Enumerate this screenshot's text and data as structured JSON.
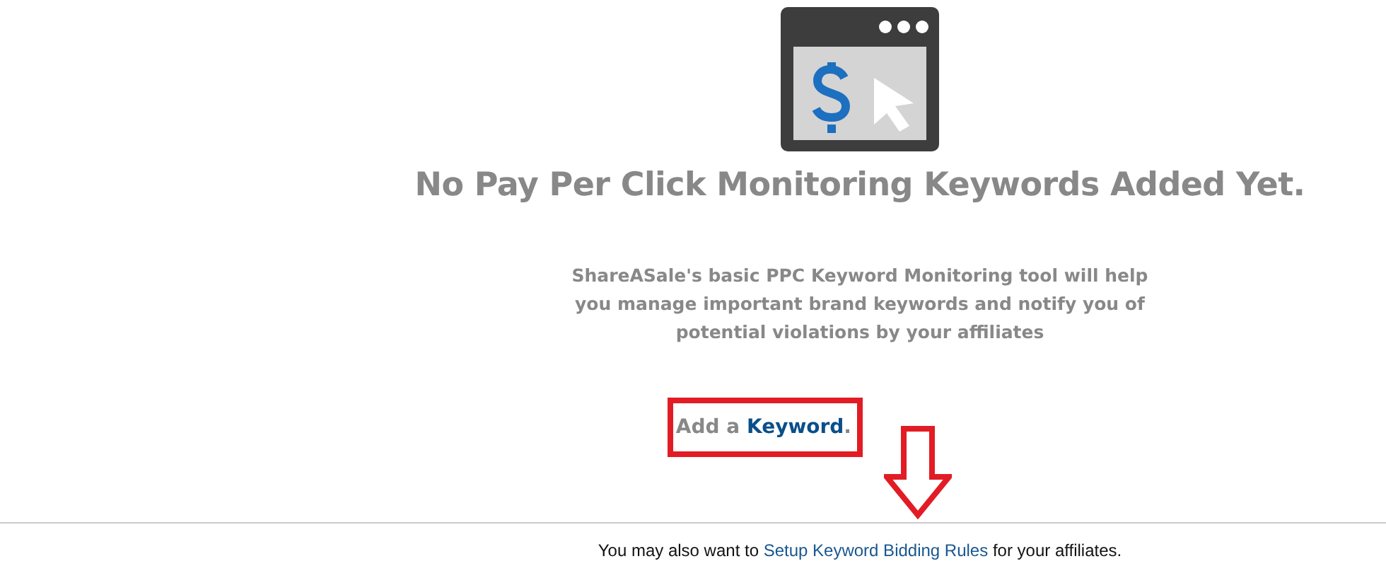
{
  "heading": "No Pay Per Click Monitoring Keywords Added Yet.",
  "description": "ShareASale's basic PPC Keyword Monitoring tool will help you manage important brand keywords and notify you of potential violations by your affiliates",
  "add_keyword": {
    "prefix": "Add a ",
    "link": "Keyword",
    "suffix": "."
  },
  "note": {
    "prefix": "You may also want to ",
    "link": "Setup Keyword Bidding Rules",
    "suffix": " for your affiliates."
  }
}
